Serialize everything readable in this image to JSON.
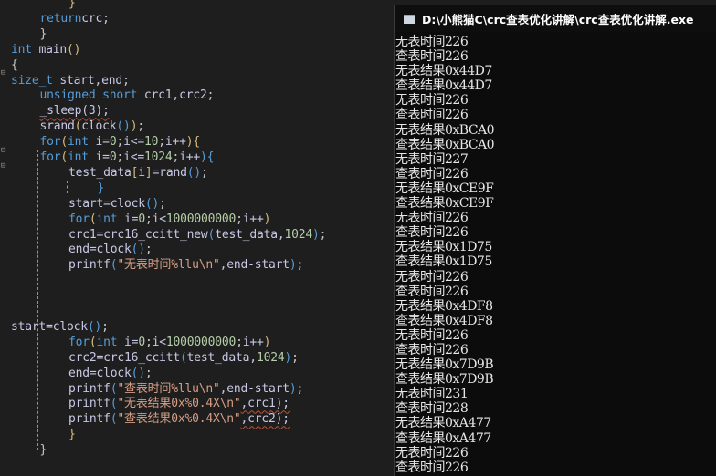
{
  "editor": {
    "lines": [
      [
        [
          "br",
          "}"
        ]
      ],
      [
        [
          "kw",
          "return"
        ],
        [
          "",
          "crc"
        ],
        [
          "pn",
          ";"
        ]
      ],
      [
        [
          "pn",
          "}"
        ]
      ],
      [
        [
          "kw",
          "int"
        ],
        [
          "",
          " main"
        ],
        [
          "br",
          "()"
        ]
      ],
      [
        [
          "pn",
          "{"
        ]
      ],
      [
        [
          "kw",
          "size_t"
        ],
        [
          "",
          " start"
        ],
        [
          "pn",
          ","
        ],
        [
          "",
          "end"
        ],
        [
          "pn",
          ";"
        ]
      ],
      [
        [
          "kw",
          "unsigned short"
        ],
        [
          "",
          " crc1"
        ],
        [
          "pn",
          ","
        ],
        [
          "",
          "crc2"
        ],
        [
          "pn",
          ";"
        ]
      ],
      [
        [
          "sq",
          "_sleep(3);"
        ]
      ],
      [
        [
          "",
          "srand"
        ],
        [
          "br",
          "("
        ],
        [
          "",
          "clock"
        ],
        [
          "kw",
          "()"
        ],
        [
          "br",
          ")"
        ],
        [
          "pn",
          ";"
        ]
      ],
      [
        [
          "kw",
          "for"
        ],
        [
          "br",
          "("
        ],
        [
          "kw",
          "int"
        ],
        [
          "",
          " i="
        ],
        [
          "num",
          "0"
        ],
        [
          "pn",
          ";"
        ],
        [
          "",
          "i<="
        ],
        [
          "num",
          "10"
        ],
        [
          "pn",
          ";"
        ],
        [
          "",
          "i++"
        ],
        [
          "br",
          "){"
        ]
      ],
      [
        [
          "kw",
          "for"
        ],
        [
          "br",
          "("
        ],
        [
          "kw",
          "int"
        ],
        [
          "",
          " i="
        ],
        [
          "num",
          "0"
        ],
        [
          "pn",
          ";"
        ],
        [
          "",
          "i<="
        ],
        [
          "num",
          "1024"
        ],
        [
          "pn",
          ";"
        ],
        [
          "",
          "i++"
        ],
        [
          "kw",
          "){"
        ]
      ],
      [
        [
          "",
          "test_data"
        ],
        [
          "br",
          "["
        ],
        [
          "",
          "i"
        ],
        [
          "br",
          "]"
        ],
        [
          "",
          "=rand"
        ],
        [
          "kw",
          "()"
        ],
        [
          "pn",
          ";"
        ]
      ],
      [
        [
          "kw",
          "}"
        ]
      ],
      [
        [
          "",
          "start=clock"
        ],
        [
          "kw",
          "()"
        ],
        [
          "pn",
          ";"
        ]
      ],
      [
        [
          "kw",
          "for"
        ],
        [
          "br",
          "("
        ],
        [
          "kw",
          "int"
        ],
        [
          "",
          " i="
        ],
        [
          "num",
          "0"
        ],
        [
          "pn",
          ";"
        ],
        [
          "",
          "i<"
        ],
        [
          "num",
          "1000000000"
        ],
        [
          "pn",
          ";"
        ],
        [
          "",
          "i++"
        ],
        [
          "br",
          ")"
        ]
      ],
      [
        [
          "",
          "crc1=crc16_ccitt_new"
        ],
        [
          "kw",
          "("
        ],
        [
          "",
          "test_data,"
        ],
        [
          "num",
          "1024"
        ],
        [
          "kw",
          ")"
        ],
        [
          "pn",
          ";"
        ]
      ],
      [
        [
          "",
          "end=clock"
        ],
        [
          "kw",
          "()"
        ],
        [
          "pn",
          ";"
        ]
      ],
      [
        [
          "",
          "printf"
        ],
        [
          "kw",
          "("
        ],
        [
          "str",
          "\"无表时间%llu\\n\""
        ],
        [
          "",
          ",end-start"
        ],
        [
          "kw",
          ")"
        ],
        [
          "pn",
          ";"
        ]
      ],
      [],
      [],
      [],
      [
        [
          "",
          "start=clock"
        ],
        [
          "kw",
          "()"
        ],
        [
          "pn",
          ";"
        ]
      ],
      [
        [
          "kw",
          "for"
        ],
        [
          "br",
          "("
        ],
        [
          "kw",
          "int"
        ],
        [
          "",
          " i="
        ],
        [
          "num",
          "0"
        ],
        [
          "pn",
          ";"
        ],
        [
          "",
          "i<"
        ],
        [
          "num",
          "1000000000"
        ],
        [
          "pn",
          ";"
        ],
        [
          "",
          "i++"
        ],
        [
          "br",
          ")"
        ]
      ],
      [
        [
          "",
          "crc2=crc16_ccitt"
        ],
        [
          "kw",
          "("
        ],
        [
          "",
          "test_data,"
        ],
        [
          "num",
          "1024"
        ],
        [
          "kw",
          ")"
        ],
        [
          "pn",
          ";"
        ]
      ],
      [
        [
          "",
          "end=clock"
        ],
        [
          "kw",
          "()"
        ],
        [
          "pn",
          ";"
        ]
      ],
      [
        [
          "",
          "printf"
        ],
        [
          "kw",
          "("
        ],
        [
          "str",
          "\"查表时间%llu\\n\""
        ],
        [
          "",
          ",end-start"
        ],
        [
          "kw",
          ")"
        ],
        [
          "pn",
          ";"
        ]
      ],
      [
        [
          "",
          "printf"
        ],
        [
          "kw",
          "("
        ],
        [
          "str",
          "\"无表结果0x%0.4X\\n\""
        ],
        [
          "sq",
          ",crc1);"
        ]
      ],
      [
        [
          "",
          "printf"
        ],
        [
          "kw",
          "("
        ],
        [
          "str",
          "\"查表结果0x%0.4X\\n\""
        ],
        [
          "sq",
          ",crc2);"
        ]
      ],
      [
        [
          "br",
          "}"
        ]
      ],
      [
        [
          "pn",
          "}"
        ]
      ]
    ],
    "indents": [
      2,
      1,
      1,
      0,
      0,
      0,
      1,
      1,
      1,
      1,
      1,
      2,
      3,
      2,
      2,
      2,
      2,
      2,
      2,
      0,
      0,
      0,
      2,
      2,
      2,
      2,
      2,
      2,
      2,
      1,
      0
    ]
  },
  "console": {
    "title": "D:\\小熊猫C\\crc查表优化讲解\\crc查表优化讲解.exe",
    "output": [
      "无表时间226",
      "查表时间226",
      "无表结果0x44D7",
      "查表结果0x44D7",
      "无表时间226",
      "查表时间226",
      "无表结果0xBCA0",
      "查表结果0xBCA0",
      "无表时间227",
      "查表时间226",
      "无表结果0xCE9F",
      "查表结果0xCE9F",
      "无表时间226",
      "查表时间226",
      "无表结果0x1D75",
      "查表结果0x1D75",
      "无表时间226",
      "查表时间226",
      "无表结果0x4DF8",
      "查表结果0x4DF8",
      "无表时间226",
      "查表时间226",
      "无表结果0x7D9B",
      "查表结果0x7D9B",
      "无表时间231",
      "查表时间228",
      "无表结果0xA477",
      "查表结果0xA477",
      "无表时间226",
      "查表时间226"
    ]
  }
}
